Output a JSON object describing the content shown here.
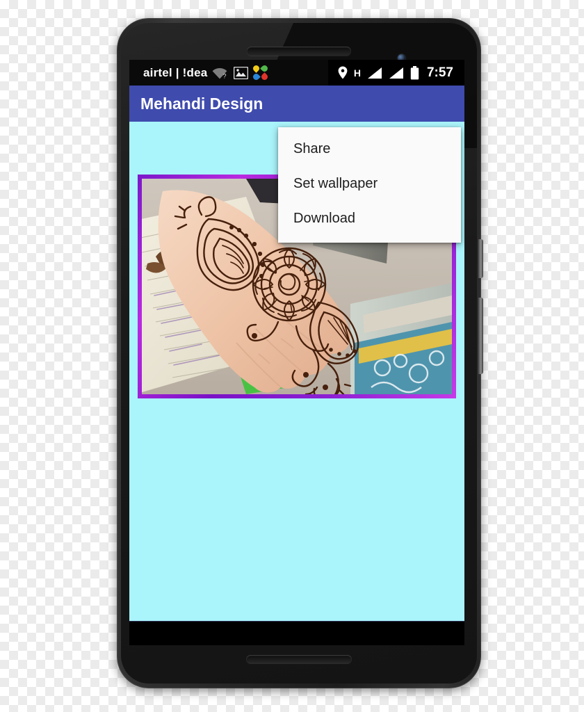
{
  "device": {
    "type": "android-smartphone",
    "frame_color": "#2a2a2a"
  },
  "status_bar": {
    "carrier": "airtel | !dea",
    "left_icons": [
      "wifi-question-icon",
      "image-icon",
      "clover-icon"
    ],
    "right_icons": [
      "location-pin-icon",
      "hspa-icon",
      "signal-bar-icon",
      "signal-bar-icon",
      "battery-icon"
    ],
    "network_type": "H",
    "clock": "7:57",
    "background": "#0a0a0a"
  },
  "app_bar": {
    "title": "Mehandi Design",
    "background": "#3f4bad",
    "text_color": "#ffffff"
  },
  "menu": {
    "items": [
      {
        "label": "Share"
      },
      {
        "label": "Set wallpaper"
      },
      {
        "label": "Download"
      }
    ],
    "background": "#fafafa"
  },
  "content": {
    "background": "#aaf4fb",
    "image": {
      "alt": "Mehandi henna design on back of hand resting on an open notebook with a green pen",
      "border_gradient_from": "#7b18c9",
      "border_gradient_to": "#c63ae8"
    }
  },
  "nav_bar": {
    "buttons": [
      {
        "name": "back",
        "icon": "triangle-left-icon"
      },
      {
        "name": "home",
        "icon": "circle-icon"
      },
      {
        "name": "recents",
        "icon": "square-icon"
      }
    ],
    "background": "#000000"
  }
}
